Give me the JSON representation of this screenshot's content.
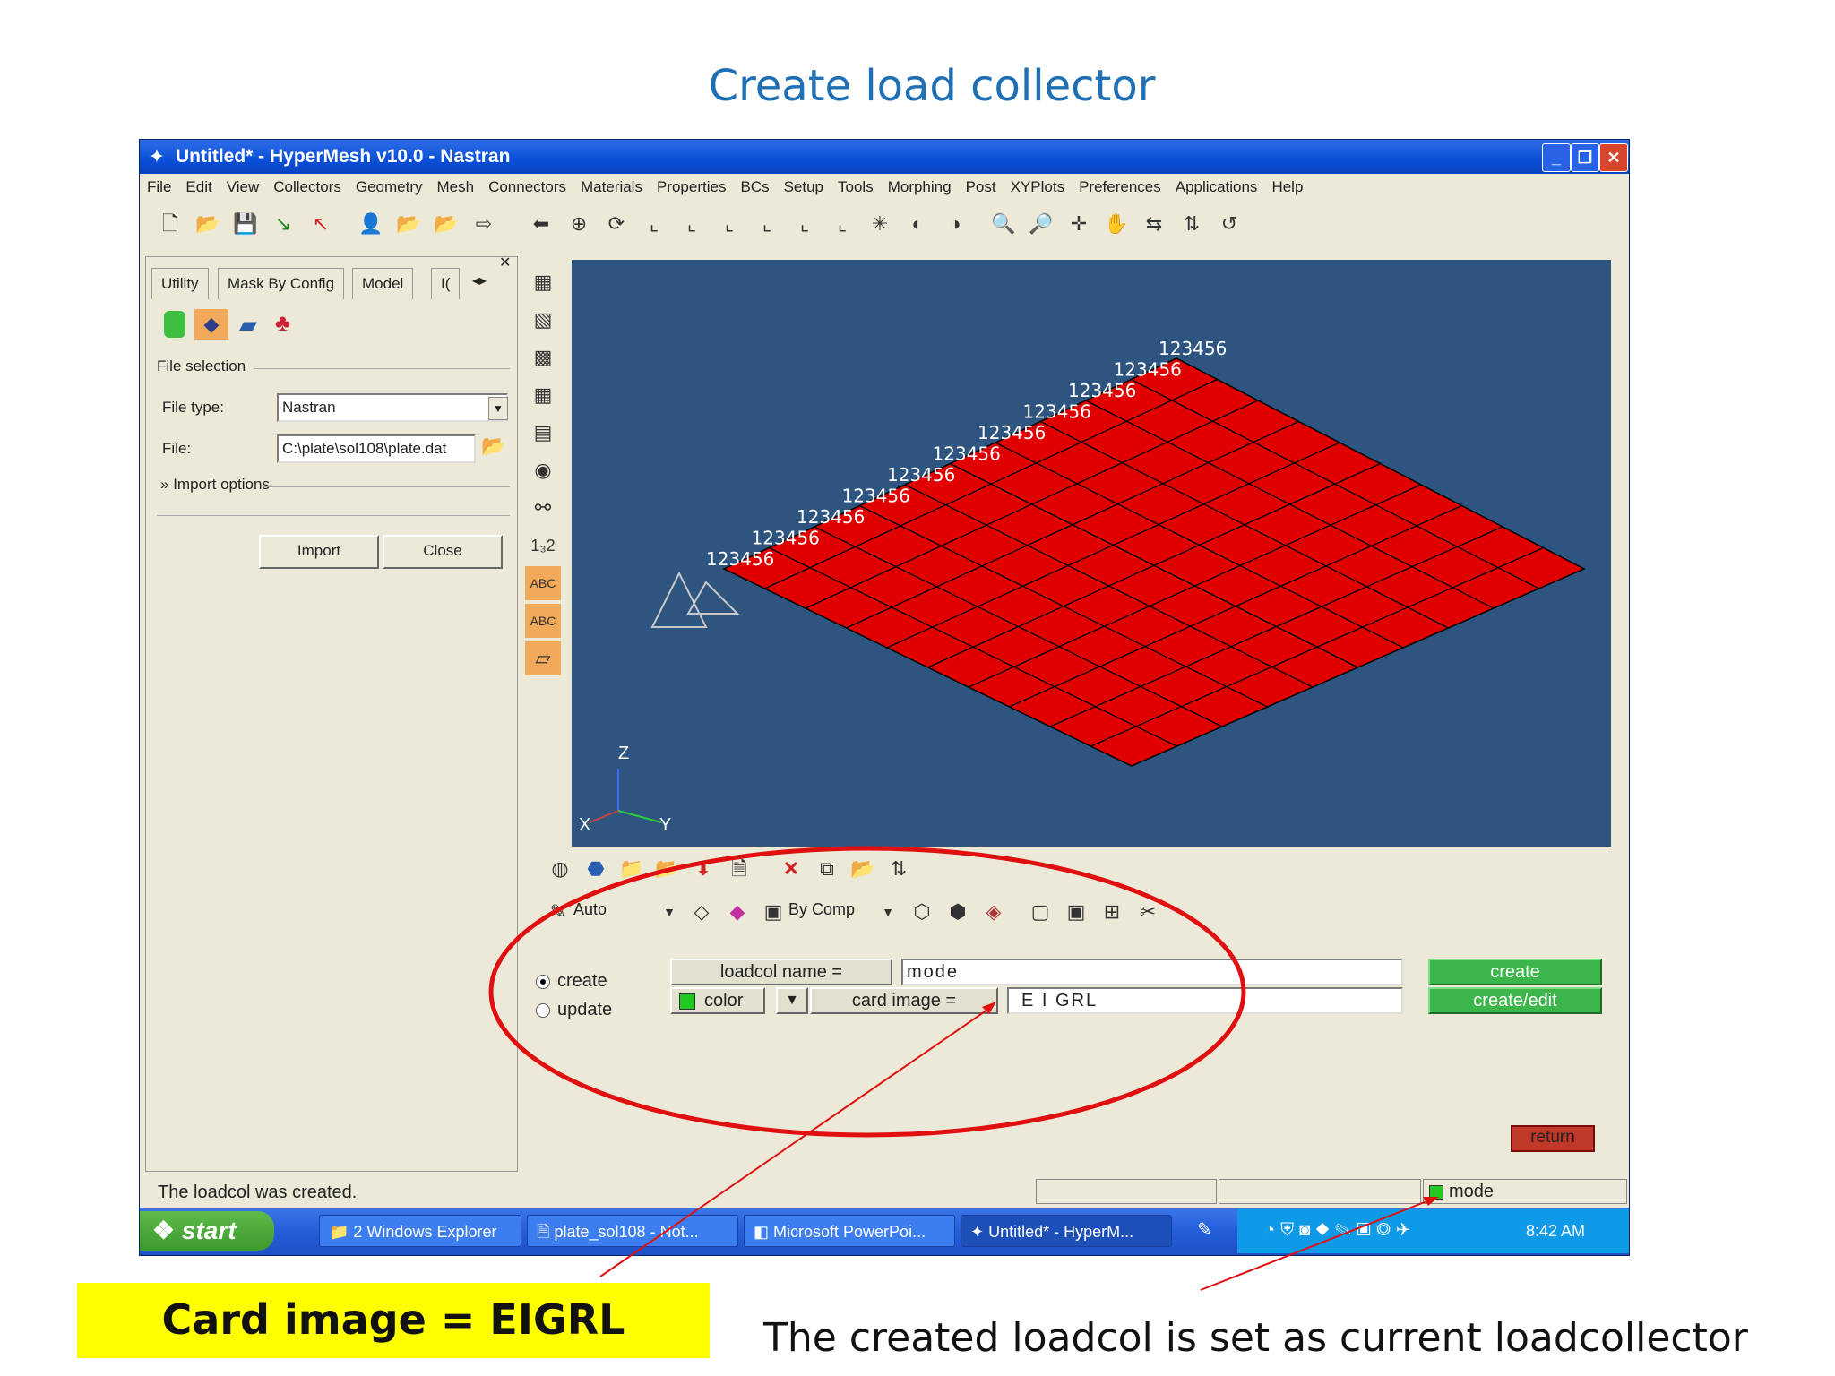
{
  "slide": {
    "title": "Create load collector",
    "caption_card_image": "Card image = EIGRL",
    "caption_current": "The created  loadcol is set as current loadcollector"
  },
  "window": {
    "title": "Untitled* - HyperMesh v10.0 - Nastran",
    "buttons": {
      "minimize": "_",
      "restore": "❐",
      "close": "✕"
    }
  },
  "menu": [
    "File",
    "Edit",
    "View",
    "Collectors",
    "Geometry",
    "Mesh",
    "Connectors",
    "Materials",
    "Properties",
    "BCs",
    "Setup",
    "Tools",
    "Morphing",
    "Post",
    "XYPlots",
    "Preferences",
    "Applications",
    "Help"
  ],
  "left_panel": {
    "tabs": [
      "Utility",
      "Mask By Config",
      "Model",
      "I("
    ],
    "section": "File selection",
    "file_type_label": "File type:",
    "file_type_value": "Nastran",
    "file_label": "File:",
    "file_value": "C:\\plate\\sol108\\plate.dat",
    "import_options": "Import options",
    "import_button": "Import",
    "close_button": "Close"
  },
  "viewport": {
    "node_label": "123456",
    "axis_z": "Z",
    "axis_x": "X",
    "axis_y": "Y",
    "element_color": "#e00000",
    "background_color": "#2e5480"
  },
  "lower_toolbar": {
    "display_mode": "Auto",
    "color_mode": "By Comp"
  },
  "panel": {
    "radio_create": "create",
    "radio_update": "update",
    "loadcol_name_label": "loadcol name =",
    "loadcol_name_value": "mode",
    "color_label": "color",
    "card_image_label": "card image =",
    "card_image_value": "E I GRL",
    "create_button": "create",
    "create_edit_button": "create/edit",
    "return_button": "return"
  },
  "status": {
    "message": "The loadcol was created.",
    "current_collector": "mode"
  },
  "taskbar": {
    "start": "start",
    "tasks": [
      "2 Windows Explorer",
      "plate_sol108 - Not...",
      "Microsoft PowerPoi...",
      "Untitled* - HyperM..."
    ],
    "clock": "8:42 AM"
  }
}
